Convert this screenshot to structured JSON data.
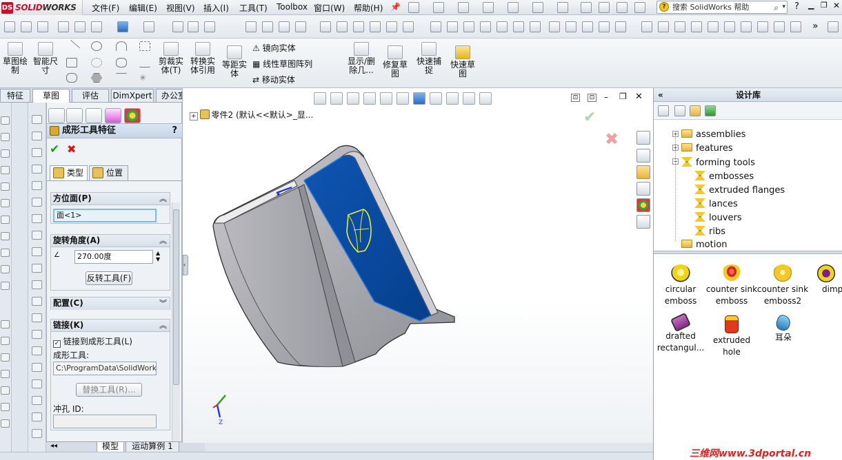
{
  "app": {
    "logo_text_a": "SOLID",
    "logo_text_b": "WORKS",
    "logo_mark": "DS"
  },
  "menu": [
    "文件(F)",
    "编辑(E)",
    "视图(V)",
    "插入(I)",
    "工具(T)",
    "Toolbox",
    "窗口(W)",
    "帮助(H)"
  ],
  "search": {
    "placeholder": "搜索 SolidWorks 帮助"
  },
  "ribbon": {
    "sketch": "草图绘\n制",
    "smart_dim": "智能尺\n寸",
    "trim": "剪裁实\n体(T)",
    "convert": "转换实\n体引用",
    "offset": "等距实\n体",
    "mirror": "镜向实体",
    "linear_pattern": "线性草图阵列",
    "move": "移动实体",
    "show_delete": "显示/删\n除几...",
    "repair": "修复草\n图",
    "quick_snap": "快速捕\n捉",
    "rapid_sketch": "快速草\n图"
  },
  "tabs": [
    "特征",
    "草图",
    "评估",
    "DimXpert",
    "办公室产品"
  ],
  "active_tab": "草图",
  "property_manager": {
    "title": "成形工具特征",
    "help": "?",
    "tab_type": "类型",
    "tab_position": "位置",
    "group_face": {
      "title": "方位面(P)",
      "value": "面<1>"
    },
    "group_rotation": {
      "title": "旋转角度(A)",
      "value": "270.00度",
      "flip_button": "反转工具(F)"
    },
    "group_config": {
      "title": "配置(C)"
    },
    "group_link": {
      "title": "链接(K)",
      "checkbox_label": "链接到成形工具(L)",
      "tool_label": "成形工具:",
      "tool_path": "C:\\ProgramData\\SolidWorks\\S",
      "replace_button": "替换工具(R)...",
      "punch_label": "冲孔 ID:"
    }
  },
  "bottom_tabs": [
    "模型",
    "运动算例 1"
  ],
  "viewport": {
    "tree_label": "零件2  (默认<<默认>_显..."
  },
  "design_library": {
    "title": "设计库",
    "back": "«",
    "tree": [
      {
        "label": "assemblies",
        "icon": "folder-icon",
        "expander": "+"
      },
      {
        "label": "features",
        "icon": "folder-icon",
        "expander": "+"
      },
      {
        "label": "forming tools",
        "icon": "forming-tool-icon",
        "expander": "−"
      },
      {
        "label": "embosses",
        "icon": "forming-tool-icon"
      },
      {
        "label": "extruded flanges",
        "icon": "forming-tool-icon"
      },
      {
        "label": "lances",
        "icon": "forming-tool-icon"
      },
      {
        "label": "louvers",
        "icon": "forming-tool-icon"
      },
      {
        "label": "ribs",
        "icon": "forming-tool-icon"
      },
      {
        "label": "motion",
        "icon": "folder-icon"
      }
    ],
    "items": [
      {
        "label_1": "circular",
        "label_2": "emboss",
        "color": "#f2d21a"
      },
      {
        "label_1": "counter sink",
        "label_2": "emboss",
        "color": "#d8261e"
      },
      {
        "label_1": "counter sink",
        "label_2": "emboss2",
        "color": "#f0c92b"
      },
      {
        "label_1": "dimp",
        "label_2": "",
        "color": "#7b1f8a"
      },
      {
        "label_1": "drafted",
        "label_2": "rectangul...",
        "color": "#8a2a8a"
      },
      {
        "label_1": "extruded",
        "label_2": "hole",
        "color": "#e03a1a"
      },
      {
        "label_1": "耳朵",
        "label_2": "",
        "color": "#3a9fd6"
      }
    ]
  },
  "watermark": "三维网www.3dportal.cn",
  "colors": {
    "accent_blue": "#0a4aa0",
    "part_gray": "#a8a8b0",
    "ok_green": "#1a9a1a",
    "cancel_red": "#d41818"
  }
}
